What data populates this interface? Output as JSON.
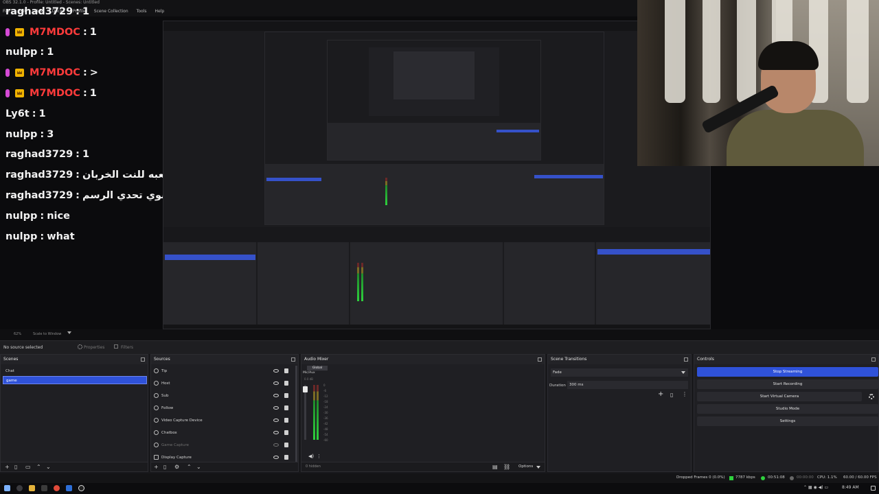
{
  "window": {
    "title": "OBS 32.1.0 - Profile: Untitled - Scenes: Untitled",
    "menu": [
      "File",
      "Edit",
      "View",
      "Docks",
      "Profile",
      "Scene Collection",
      "Tools",
      "Help"
    ]
  },
  "chat": {
    "lines": [
      {
        "user": "raghad3729",
        "msg": "1",
        "badges": false,
        "red": false
      },
      {
        "user": "M7MDOC",
        "msg": "1",
        "badges": true,
        "red": true
      },
      {
        "user": "nulpp",
        "msg": "1",
        "badges": false,
        "red": false
      },
      {
        "user": "M7MDOC",
        "msg": ">",
        "badges": true,
        "red": true
      },
      {
        "user": "M7MDOC",
        "msg": "1",
        "badges": true,
        "red": true
      },
      {
        "user": "Ly6t",
        "msg": "1",
        "badges": false,
        "red": false
      },
      {
        "user": "nulpp",
        "msg": "3",
        "badges": false,
        "red": false
      },
      {
        "user": "raghad3729",
        "msg": "1",
        "badges": false,
        "red": false
      },
      {
        "user": "raghad3729",
        "msg": "نبي لعبه للنت الخربان",
        "badges": false,
        "red": false
      },
      {
        "user": "raghad3729",
        "msg": "سوي تحدي الرسم",
        "badges": false,
        "red": false
      },
      {
        "user": "nulpp",
        "msg": "nice",
        "badges": false,
        "red": false
      },
      {
        "user": "nulpp",
        "msg": "what",
        "badges": false,
        "red": false
      }
    ]
  },
  "zoombar": {
    "zoom": "62%",
    "scale": "Scale to Window"
  },
  "propbar": {
    "selection": "No source selected",
    "properties": "Properties",
    "filters": "Filters"
  },
  "scenes": {
    "title": "Scenes",
    "items": [
      {
        "label": "Chat",
        "active": false
      },
      {
        "label": "game",
        "active": true
      }
    ]
  },
  "sources": {
    "title": "Sources",
    "items": [
      {
        "label": "Tip",
        "dim": false
      },
      {
        "label": "Host",
        "dim": false
      },
      {
        "label": "Sub",
        "dim": false
      },
      {
        "label": "Follow",
        "dim": false
      },
      {
        "label": "Video Capture Device",
        "dim": false
      },
      {
        "label": "Chatbox",
        "dim": false
      },
      {
        "label": "Game Capture",
        "dim": true
      },
      {
        "label": "Display Capture",
        "dim": false
      }
    ]
  },
  "mixer": {
    "title": "Audio Mixer",
    "tab": "Global",
    "source": "Mic/Aux",
    "db": "0.0 dB",
    "ticks": [
      "0",
      "-6",
      "-12",
      "-18",
      "-24",
      "-30",
      "-36",
      "-42",
      "-48",
      "-54",
      "-60"
    ],
    "hidden": "0 hidden",
    "options": "Options"
  },
  "transitions": {
    "title": "Scene Transitions",
    "selected": "Fade",
    "duration_label": "Duration",
    "duration_value": "300 ms"
  },
  "controls": {
    "title": "Controls",
    "buttons": [
      "Stop Streaming",
      "Start Recording",
      "Start Virtual Camera",
      "Studio Mode",
      "Settings"
    ]
  },
  "status": {
    "dropped": "Dropped Frames 0 (0.0%)",
    "bitrate": "7787 kbps",
    "stream_time": "00:51:08",
    "rec_time": "00:00:00",
    "cpu": "CPU: 1.1%",
    "fps": "60.00 / 60.00 FPS"
  },
  "taskbar": {
    "clock": "8:49 AM"
  },
  "colors": {
    "accent": "#2f52d9",
    "chat_red": "#ff3b3b",
    "meter_green": "#2ed13d"
  }
}
